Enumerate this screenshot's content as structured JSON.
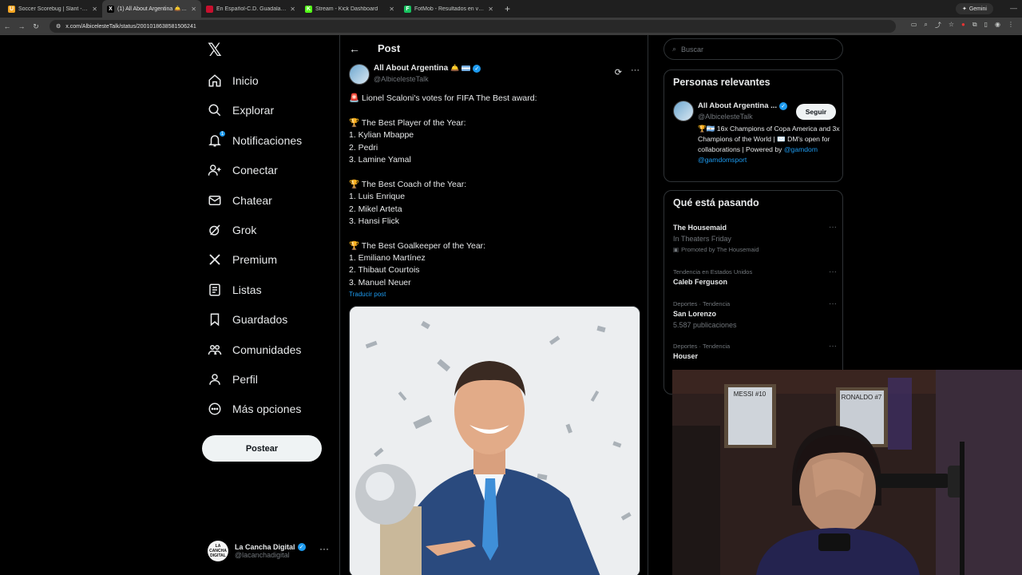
{
  "browser": {
    "tabs": [
      {
        "title": "Soccer Scorebug | Slant - over...",
        "fav_color": "#f5a623",
        "fav_letter": "U",
        "active": false
      },
      {
        "title": "(1) All About Argentina 🛎️ en...",
        "fav_color": "#000000",
        "fav_letter": "X",
        "active": true
      },
      {
        "title": "En Español-C.D. Guadalaja...",
        "fav_color": "#c8102e",
        "fav_letter": "",
        "active": false
      },
      {
        "title": "Stream - Kick Dashboard",
        "fav_color": "#53fc18",
        "fav_letter": "K",
        "active": false
      },
      {
        "title": "FotMob - Resultados en vivo d...",
        "fav_color": "#17c25f",
        "fav_letter": "F",
        "active": false
      }
    ],
    "gemini_label": "Gemini",
    "url": "x.com/AlbicelesteTalk/status/2001018638581506241"
  },
  "nav": {
    "items": [
      {
        "label": "Inicio",
        "icon": "home-icon"
      },
      {
        "label": "Explorar",
        "icon": "search-icon"
      },
      {
        "label": "Notificaciones",
        "icon": "bell-icon",
        "badge": "1"
      },
      {
        "label": "Conectar",
        "icon": "person-add-icon"
      },
      {
        "label": "Chatear",
        "icon": "mail-icon"
      },
      {
        "label": "Grok",
        "icon": "grok-icon"
      },
      {
        "label": "Premium",
        "icon": "x-premium-icon"
      },
      {
        "label": "Listas",
        "icon": "list-icon"
      },
      {
        "label": "Guardados",
        "icon": "bookmark-icon"
      },
      {
        "label": "Comunidades",
        "icon": "communities-icon"
      },
      {
        "label": "Perfil",
        "icon": "profile-icon"
      },
      {
        "label": "Más opciones",
        "icon": "more-circle-icon"
      }
    ],
    "post_button": "Postear",
    "account": {
      "name": "La Cancha Digital",
      "handle": "@lacanchadigital",
      "avatar_text": "LA CANCHA DIGITAL"
    }
  },
  "post": {
    "header_title": "Post",
    "author_name": "All About Argentina",
    "author_handle": "@AlbicelesteTalk",
    "lines": [
      "🚨 Lionel Scaloni's votes for FIFA The Best award:",
      "",
      "🏆 The Best Player of the Year:",
      "1. Kylian Mbappe",
      "2. Pedri",
      "3. Lamine Yamal",
      "",
      "🏆 The Best Coach of the Year:",
      "1. Luis Enrique",
      "2. Mikel Arteta",
      "3. Hansi Flick",
      "",
      "🏆 The Best Goalkeeper of the Year:",
      "1. Emiliano Martínez",
      "2. Thibaut Courtois",
      "3. Manuel Neuer"
    ],
    "translate_label": "Traducir post"
  },
  "sidebar": {
    "search_placeholder": "Buscar",
    "relevant": {
      "title": "Personas relevantes",
      "name": "All About Argentina ...",
      "handle": "@AlbicelesteTalk",
      "follow_label": "Seguir",
      "bio_text": "🏆🇦🇷 16x Champions of Copa America and 3x Champions of the World | ✉️ DM's open for collaborations | Powered by ",
      "bio_link1": "@gamdom",
      "bio_link2": "@gamdomsport"
    },
    "trends": {
      "title": "Qué está pasando",
      "items": [
        {
          "meta": "",
          "name": "The Housemaid",
          "sub": "In Theaters Friday",
          "promo": "Promoted by The Housemaid"
        },
        {
          "meta": "Tendencia en Estados Unidos",
          "name": "Caleb Ferguson",
          "sub": "",
          "promo": ""
        },
        {
          "meta": "Deportes · Tendencia",
          "name": "San Lorenzo",
          "sub": "5.587 publicaciones",
          "promo": ""
        },
        {
          "meta": "Deportes · Tendencia",
          "name": "Houser",
          "sub": "",
          "promo": ""
        }
      ]
    }
  },
  "webcam": {
    "poster1": "MESSI #10",
    "poster2": "RONALDO #7"
  }
}
